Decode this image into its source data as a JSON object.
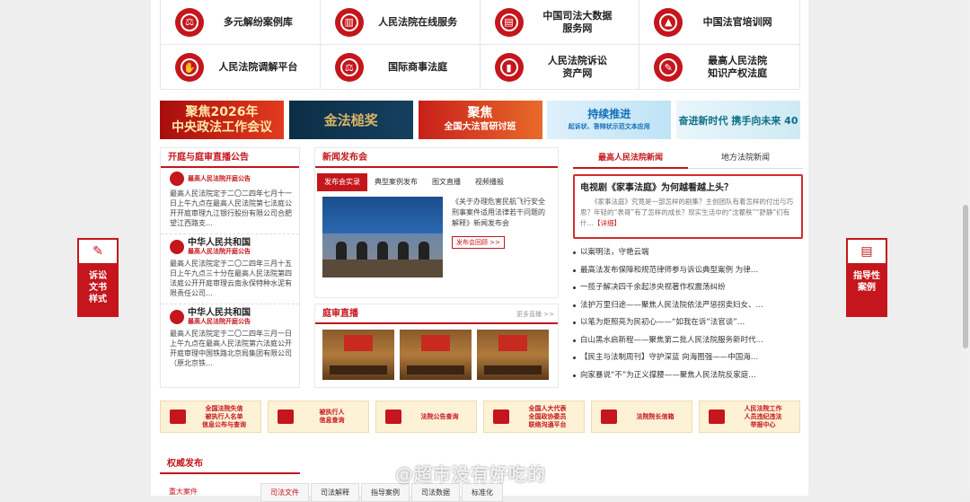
{
  "grid": [
    {
      "label": "多元解纷案例库",
      "icon": "balance-icon"
    },
    {
      "label": "人民法院在线服务",
      "icon": "court-icon"
    },
    {
      "label": "中国司法大数据服务网",
      "line1": "中国司法大数据",
      "line2": "服务网",
      "icon": "data-icon"
    },
    {
      "label": "中国法官培训网",
      "icon": "graduation-icon"
    },
    {
      "label": "人民法院调解平台",
      "icon": "handshake-icon"
    },
    {
      "label": "国际商事法庭",
      "icon": "scales-icon"
    },
    {
      "label": "人民法院诉讼资产网",
      "line1": "人民法院诉讼",
      "line2": "资产网",
      "icon": "book-icon"
    },
    {
      "label": "最高人民法院知识产权法庭",
      "line1": "最高人民法院",
      "line2": "知识产权法庭",
      "icon": "certificate-icon"
    }
  ],
  "banners": [
    {
      "l1": "聚焦2026年",
      "l2": "中央政法工作会议"
    },
    {
      "l1": "金法槌奖",
      "l2": ""
    },
    {
      "l1": "聚焦",
      "l2": "全国大法官研讨班"
    },
    {
      "l1": "持续推进",
      "l2": "起诉状、答辩状示范文本应用"
    },
    {
      "l1": "奋进新时代 携手向未来 40",
      "l2": ""
    }
  ],
  "kaiting": {
    "title": "开庭与庭审直播公告",
    "notices": [
      {
        "org": "最高人民法院开庭公告",
        "text": "最高人民法院定于二〇二四年七月十一日上午九点在最高人民法院第七法庭公开开庭审理九江银行股份有限公司合肥望江西路支…"
      },
      {
        "org1": "中华人民共和国",
        "org": "最高人民法院开庭公告",
        "text": "最高人民法院定于二〇二四年三月十五日上午九点三十分在最高人民法院第四法庭公开开庭审理云南永保特种水泥有限责任公司…"
      },
      {
        "org1": "中华人民共和国",
        "org": "最高人民法院开庭公告",
        "text": "最高人民法院定于二〇二四年三月一日上午九点在最高人民法院第六法庭公开开庭审理中国铁路北京局集团有限公司（原北京铁…"
      }
    ]
  },
  "news": {
    "title": "新闻发布会",
    "tabs": [
      "发布会实录",
      "典型案例发布",
      "图文直播",
      "视频播报"
    ],
    "desc": "《关于办理危害民航飞行安全刑事案件适用法律若干问题的解释》新闻发布会",
    "btn": "发布会回顾 >>"
  },
  "live": {
    "title": "庭审直播",
    "more": "更多直播 >>"
  },
  "center": {
    "tabs": [
      "最高人民法院新闻",
      "地方法院新闻"
    ],
    "feature_title": "电视剧《家事法庭》为何越看越上头？",
    "feature_desc": "《家事法庭》究竟是一部怎样的剧集？主创团队有着怎样的付出与巧思？年轻的“表哥”有了怎样的成长？现实生活中的“沈瞿秩”“舒静”们有什…",
    "feature_more": "【详细】",
    "items": [
      "以案明法，守艳云端",
      "最高法发布保障和规范律师参与诉讼典型案例 为律…",
      "一揽子解决四千余起涉央视著作权震荡纠纷",
      "法护万里归途——聚焦人民法院依法严惩拐卖妇女、…",
      "以笔为炬照亮为民初心——“如我在诉”法官谈”…",
      "白山黑水启新程——聚焦第二批人民法院服务新时代…",
      "【民主与法制周刊】守护深蓝 向海图强——中国海…",
      "向家暴说“不”为正义撑腰——聚焦人民法院反家庭…"
    ]
  },
  "side_left": {
    "label": "诉讼文书样式",
    "l1": "诉讼",
    "l2": "文书",
    "l3": "样式"
  },
  "side_right": {
    "label": "指导性案例",
    "l1": "指导性",
    "l2": "案例"
  },
  "services": [
    {
      "l1": "全国法院失信",
      "l2": "被执行人名单",
      "l3": "信息公布与查询"
    },
    {
      "l1": "被执行人",
      "l2": "信息查询",
      "l3": ""
    },
    {
      "l1": "法院公告查询",
      "l2": "",
      "l3": ""
    },
    {
      "l1": "全国人大代表",
      "l2": "全国政协委员",
      "l3": "联络沟通平台"
    },
    {
      "l1": "法院院长信箱",
      "l2": "",
      "l3": ""
    },
    {
      "l1": "人民法院工作",
      "l2": "人员违纪违法",
      "l3": "举报中心"
    }
  ],
  "auth": {
    "title": "权威发布",
    "tabs": [
      "重大案件",
      "司法文件",
      "司法解释",
      "指导案例",
      "司法数据",
      "标准化"
    ]
  },
  "watermark": "@超市没有好吃的"
}
